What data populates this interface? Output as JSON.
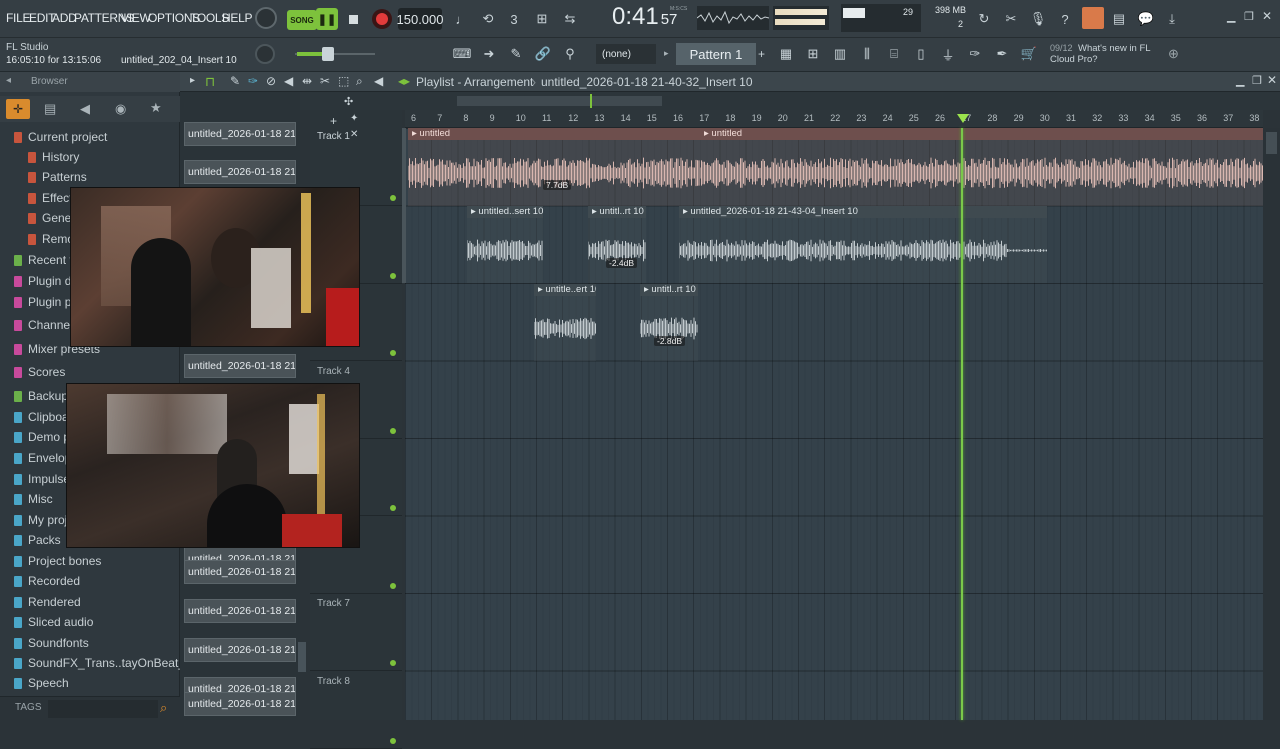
{
  "menu": [
    "FILE",
    "EDIT",
    "ADD",
    "PATTERNS",
    "VIEW",
    "OPTIONS",
    "TOOLS",
    "HELP"
  ],
  "transport": {
    "mode_label": "SONG",
    "tempo": "150.000",
    "time_main": "0:41",
    "time_sub": "57",
    "time_unit": "M:S:CS",
    "cpu_value": "29",
    "mem_value": "398 MB",
    "mem_sub": "2"
  },
  "app": {
    "name": "FL Studio",
    "session_time": "16:05:10 for 13:15:06",
    "hint_file": "untitled_202_04_Insert 10"
  },
  "pattern": {
    "selector": "(none)",
    "name": "Pattern 1",
    "news_count": "09/12",
    "news_text": "What's new in FL Cloud Pro?"
  },
  "browser": {
    "title": "Browser",
    "items": [
      {
        "label": "Current project",
        "color": "#c8553d"
      },
      {
        "label": "History",
        "color": "#c8553d"
      },
      {
        "label": "Patterns",
        "color": "#c8553d"
      },
      {
        "label": "Effects",
        "color": "#c8553d"
      },
      {
        "label": "Generators",
        "color": "#c8553d"
      },
      {
        "label": "Remote control",
        "color": "#c8553d"
      },
      {
        "label": "Recent files",
        "color": "#6bb04a"
      },
      {
        "label": "Plugin database",
        "color": "#c84a9c"
      },
      {
        "label": "Plugin presets",
        "color": "#c84a9c"
      },
      {
        "label": "Channel presets",
        "color": "#c84a9c"
      },
      {
        "label": "Mixer presets",
        "color": "#c84a9c"
      },
      {
        "label": "Scores",
        "color": "#c84a9c"
      },
      {
        "label": "Backup",
        "color": "#6bb04a"
      },
      {
        "label": "Clipboard files",
        "color": "#4aa6c8"
      },
      {
        "label": "Demo projects",
        "color": "#4aa6c8"
      },
      {
        "label": "Envelopes",
        "color": "#4aa6c8"
      },
      {
        "label": "Impulses",
        "color": "#4aa6c8"
      },
      {
        "label": "Misc",
        "color": "#4aa6c8"
      },
      {
        "label": "My projects",
        "color": "#4aa6c8"
      },
      {
        "label": "Packs",
        "color": "#4aa6c8"
      },
      {
        "label": "Project bones",
        "color": "#4aa6c8"
      },
      {
        "label": "Recorded",
        "color": "#4aa6c8"
      },
      {
        "label": "Rendered",
        "color": "#4aa6c8"
      },
      {
        "label": "Sliced audio",
        "color": "#4aa6c8"
      },
      {
        "label": "Soundfonts",
        "color": "#4aa6c8"
      },
      {
        "label": "SoundFX_Trans..tayOnBeat_com",
        "color": "#4aa6c8"
      },
      {
        "label": "Speech",
        "color": "#4aa6c8"
      }
    ],
    "tags_label": "TAGS"
  },
  "playlist": {
    "title": "Playlist - Arrangement",
    "project": "untitled_2026-01-18 21-40-32_Insert 10",
    "ruler": [
      "6",
      "7",
      "8",
      "9",
      "10",
      "11",
      "12",
      "13",
      "14",
      "15",
      "16",
      "17",
      "18",
      "19",
      "20",
      "21",
      "22",
      "23",
      "24",
      "25",
      "26",
      "27",
      "28",
      "29",
      "30",
      "31",
      "32",
      "33",
      "34",
      "35",
      "36",
      "37",
      "38"
    ],
    "tracks": [
      {
        "label": "Track 1"
      },
      {
        "label": ""
      },
      {
        "label": ""
      },
      {
        "label": "Track 4"
      },
      {
        "label": ""
      },
      {
        "label": ""
      },
      {
        "label": "Track 7"
      },
      {
        "label": "Track 8"
      }
    ],
    "channels": [
      "untitled_2026-01-18 21-...",
      "untitled_2026-01-18 21-...",
      "untitled_2026-01-18 21-...",
      "untitled_2026-01-18 21-...",
      "untitled_2026-01-18 21-...",
      "untitled_2026-01-18 21-...",
      "untitled_2026-01-18 21-...",
      "untitled_2026-01-18 21-...",
      "untitled_2026-01-18 21-...",
      "untitled_2026-01-18 21-...",
      "untitled_2026-01-18 21-..."
    ],
    "clips": [
      {
        "name": "untitled",
        "gain": "7.7dB"
      },
      {
        "name": "untitled",
        "gain": ""
      },
      {
        "name": "untitled..sert 10",
        "gain": ""
      },
      {
        "name": "untitl..rt 10",
        "gain": "-2.4dB"
      },
      {
        "name": "untitled_2026-01-18 21-43-04_Insert 10",
        "gain": ""
      },
      {
        "name": "untitle..ert 10",
        "gain": ""
      },
      {
        "name": "untitl..rt 10",
        "gain": "-2.8dB"
      }
    ]
  },
  "colors": {
    "accent_green": "#7dc23c",
    "clip_pink": "#d9b7b0",
    "clip_gray": "#7c878c",
    "playhead": "#9be34d"
  }
}
